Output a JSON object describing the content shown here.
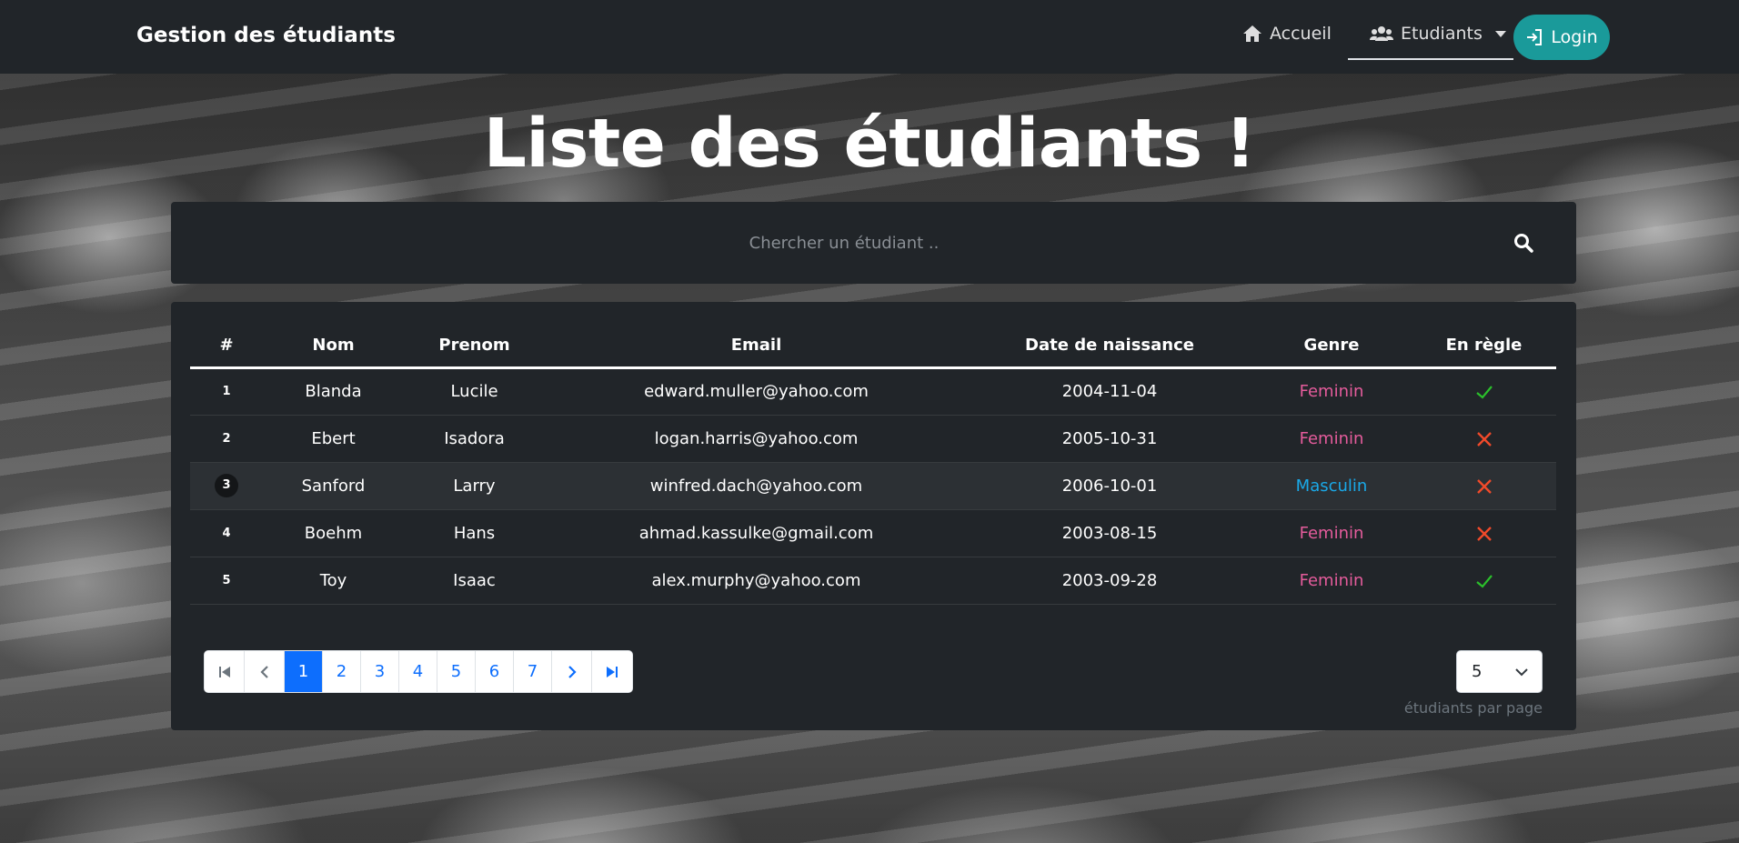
{
  "navbar": {
    "brand": "Gestion des étudiants",
    "home_label": "Accueil",
    "students_label": "Etudiants",
    "login_label": "Login"
  },
  "page": {
    "title": "Liste des étudiants !"
  },
  "search": {
    "placeholder": "Chercher un étudiant ..",
    "value": ""
  },
  "table": {
    "headers": [
      "#",
      "Nom",
      "Prenom",
      "Email",
      "Date de naissance",
      "Genre",
      "En règle"
    ],
    "rows": [
      {
        "index": "1",
        "nom": "Blanda",
        "prenom": "Lucile",
        "email": "edward.muller@yahoo.com",
        "date": "2004-11-04",
        "genre": "Feminin",
        "en_regle": true
      },
      {
        "index": "2",
        "nom": "Ebert",
        "prenom": "Isadora",
        "email": "logan.harris@yahoo.com",
        "date": "2005-10-31",
        "genre": "Feminin",
        "en_regle": false
      },
      {
        "index": "3",
        "nom": "Sanford",
        "prenom": "Larry",
        "email": "winfred.dach@yahoo.com",
        "date": "2006-10-01",
        "genre": "Masculin",
        "en_regle": false
      },
      {
        "index": "4",
        "nom": "Boehm",
        "prenom": "Hans",
        "email": "ahmad.kassulke@gmail.com",
        "date": "2003-08-15",
        "genre": "Feminin",
        "en_regle": false
      },
      {
        "index": "5",
        "nom": "Toy",
        "prenom": "Isaac",
        "email": "alex.murphy@yahoo.com",
        "date": "2003-09-28",
        "genre": "Feminin",
        "en_regle": true
      }
    ]
  },
  "pagination": {
    "pages": [
      "1",
      "2",
      "3",
      "4",
      "5",
      "6",
      "7"
    ],
    "current_page": "1"
  },
  "per_page": {
    "value": "5",
    "label": "étudiants par page"
  },
  "colors": {
    "login_button": "#1a9a9a",
    "feminin": "#e55c9c",
    "masculin": "#1aa9e8",
    "check": "#2bc02b",
    "cross": "#f04a2a",
    "active_page": "#0d6efd"
  },
  "icons": {
    "home": "home-icon",
    "students": "users-icon",
    "login": "sign-in-icon",
    "search": "search-icon",
    "valid": "check-icon",
    "invalid": "cross-icon"
  }
}
